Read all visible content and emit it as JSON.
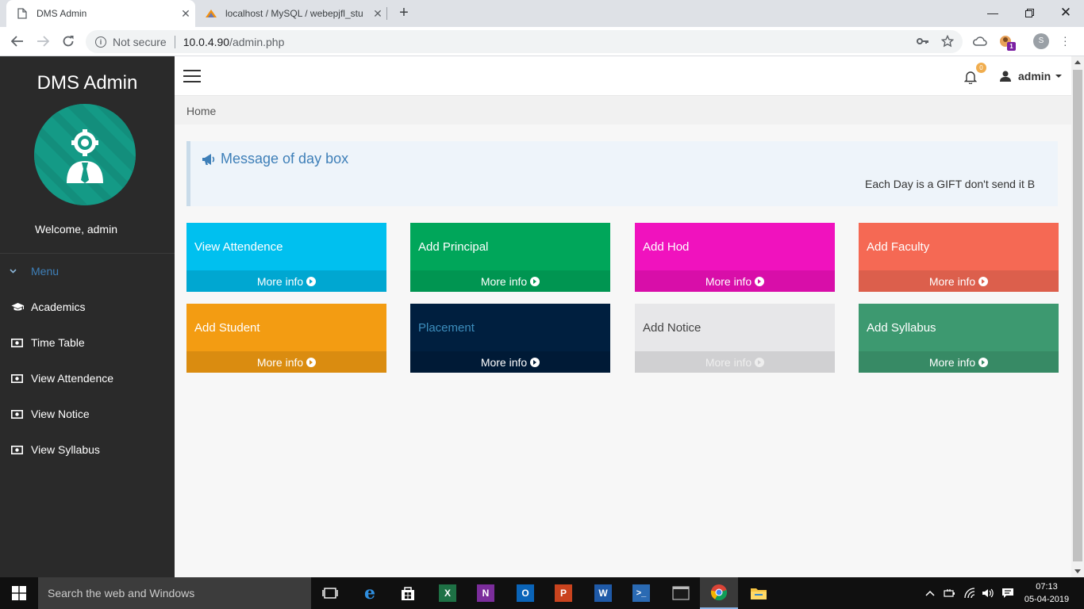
{
  "browser": {
    "tabs": [
      {
        "title": "DMS Admin",
        "active": true
      },
      {
        "title": "localhost / MySQL / webepjfl_stu",
        "active": false
      }
    ],
    "security_label": "Not secure",
    "url_host": "10.0.4.90",
    "url_path": "/admin.php",
    "extension_badge": "1",
    "profile_initial": "S"
  },
  "sidebar": {
    "brand": "DMS Admin",
    "welcome": "Welcome, admin",
    "menu_label": "Menu",
    "items": [
      {
        "label": "Academics",
        "icon": "graduation-cap-icon"
      },
      {
        "label": "Time Table",
        "icon": "money-icon"
      },
      {
        "label": "View Attendence",
        "icon": "money-icon"
      },
      {
        "label": "View Notice",
        "icon": "money-icon"
      },
      {
        "label": "View Syllabus",
        "icon": "money-icon"
      }
    ]
  },
  "header": {
    "notification_count": "0",
    "user_name": "admin"
  },
  "breadcrumb": {
    "home": "Home"
  },
  "callout": {
    "title": "Message of day box",
    "message": "Each Day is a GIFT don't send it B"
  },
  "tiles": [
    {
      "title": "View Attendence",
      "footer": "More info",
      "bg": "#00c0ef",
      "footer_bg": "#00a7d1",
      "color": "#ffffff"
    },
    {
      "title": "Add Principal",
      "footer": "More info",
      "bg": "#00a65a",
      "footer_bg": "#009551",
      "color": "#ffffff"
    },
    {
      "title": "Add Hod",
      "footer": "More info",
      "bg": "#f012be",
      "footer_bg": "#d80ea9",
      "color": "#ffffff"
    },
    {
      "title": "Add Faculty",
      "footer": "More info",
      "bg": "#f56954",
      "footer_bg": "#dc5f4c",
      "color": "#ffffff"
    },
    {
      "title": "Add Student",
      "footer": "More info",
      "bg": "#f39c12",
      "footer_bg": "#da8c10",
      "color": "#ffffff"
    },
    {
      "title": "Placement",
      "footer": "More info",
      "bg": "#001f3f",
      "footer_bg": "#001a36",
      "color": "#3c8dbc",
      "footer_color": "#ffffff"
    },
    {
      "title": "Add Notice",
      "footer": "More info",
      "bg": "#e7e7e9",
      "footer_bg": "#d0d0d2",
      "color": "#444444",
      "footer_color": "#eeeeee"
    },
    {
      "title": "Add Syllabus",
      "footer": "More info",
      "bg": "#3d9970",
      "footer_bg": "#378a65",
      "color": "#ffffff"
    }
  ],
  "taskbar": {
    "search_placeholder": "Search the web and Windows",
    "time": "07:13",
    "date": "05-04-2019"
  }
}
